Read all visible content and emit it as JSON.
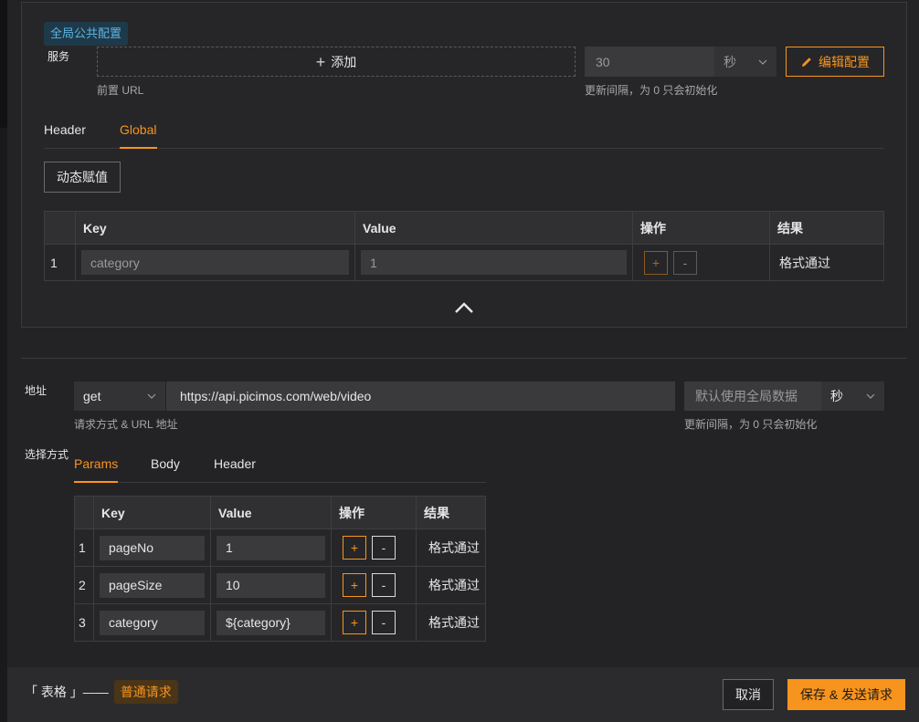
{
  "global": {
    "tag": "全局公共配置",
    "service_label": "服务",
    "add_label": "添加",
    "prefix_hint": "前置 URL",
    "interval_value": "30",
    "interval_unit": "秒",
    "interval_hint": "更新间隔，为 0 只会初始化",
    "edit_button": "编辑配置",
    "tabs": [
      "Header",
      "Global"
    ],
    "dynamic_button": "动态赋值",
    "table_headers": [
      "Key",
      "Value",
      "操作",
      "结果"
    ],
    "rows": [
      {
        "index": "1",
        "key": "category",
        "value": "1",
        "plus": "+",
        "minus": "-",
        "result": "格式通过"
      }
    ]
  },
  "request": {
    "address_label": "地址",
    "method": "get",
    "url": "https://api.picimos.com/web/video",
    "method_hint": "请求方式 & URL 地址",
    "interval_placeholder": "默认使用全局数据",
    "interval_unit": "秒",
    "interval_hint": "更新间隔，为 0 只会初始化",
    "choose_label": "选择方式",
    "tabs": [
      "Params",
      "Body",
      "Header"
    ],
    "table_headers": [
      "Key",
      "Value",
      "操作",
      "结果"
    ],
    "rows": [
      {
        "index": "1",
        "key": "pageNo",
        "value": "1",
        "plus": "+",
        "minus": "-",
        "result": "格式通过"
      },
      {
        "index": "2",
        "key": "pageSize",
        "value": "10",
        "plus": "+",
        "minus": "-",
        "result": "格式通过"
      },
      {
        "index": "3",
        "key": "category",
        "value": "${category}",
        "plus": "+",
        "minus": "-",
        "result": "格式通过"
      }
    ]
  },
  "footer": {
    "title": "「 表格 」——",
    "tag": "普通请求",
    "cancel": "取消",
    "save": "保存 & 发送请求"
  },
  "colors": {
    "accent": "#f7941d",
    "background": "#232325",
    "tag_blue": "#5fb3e0"
  },
  "icons": [
    "plus-icon",
    "chevron-down-icon",
    "pencil-icon",
    "chevron-up-icon"
  ]
}
